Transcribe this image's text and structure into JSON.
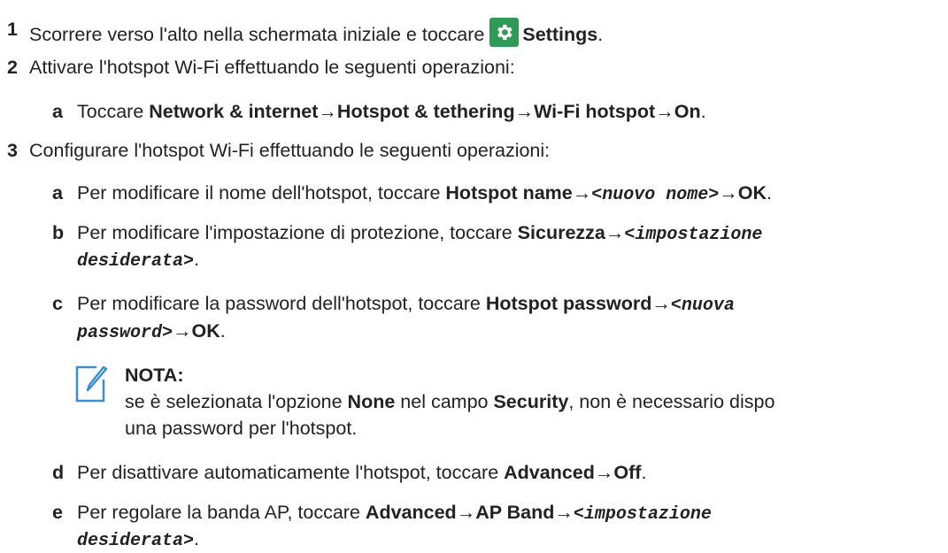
{
  "steps": [
    {
      "num": "1",
      "text": "Scorrere verso l'alto nella schermata iniziale e toccare",
      "bold": "Settings",
      "end": "."
    },
    {
      "num": "2",
      "text": "Attivare l'hotspot Wi-Fi effettuando le seguenti operazioni:"
    },
    {
      "num": "3",
      "text": "Configurare l'hotspot Wi-Fi effettuando le seguenti operazioni:"
    }
  ],
  "step2": {
    "a": {
      "letter": "a",
      "text": "Toccare",
      "p1": "Network & internet",
      "arrow": "→",
      "p2": "Hotspot & tethering",
      "p3": "Wi-Fi hotspot",
      "p4": "On",
      "end": "."
    }
  },
  "step3": {
    "a": {
      "letter": "a",
      "text": "Per modificare il nome dell'hotspot, toccare",
      "p1": "Hotspot name",
      "arrow": "→",
      "mono": "<nuovo nome>",
      "p2": "OK",
      "end": "."
    },
    "b": {
      "letter": "b",
      "text": "Per modificare l'impostazione di protezione, toccare",
      "p1": "Sicurezza",
      "arrow": "→",
      "mono1": "<impostazione",
      "mono2": "desiderata>",
      "end": "."
    },
    "c": {
      "letter": "c",
      "text": "Per modificare la password dell'hotspot, toccare",
      "p1": "Hotspot password",
      "arrow": "→",
      "mono1": "<nuova",
      "mono2": "password>",
      "p2": "OK",
      "end": "."
    },
    "note": {
      "title": "NOTA:",
      "t1": "se è selezionata l'opzione",
      "b1": "None",
      "t2": "nel campo",
      "b2": "Security",
      "t3": ", non è necessario dispo",
      "t4": "una password per l'hotspot."
    },
    "d": {
      "letter": "d",
      "text": "Per disattivare automaticamente l'hotspot, toccare",
      "p1": "Advanced",
      "arrow": "→",
      "p2": "Off",
      "end": "."
    },
    "e": {
      "letter": "e",
      "text": "Per regolare la banda AP, toccare",
      "p1": "Advanced",
      "arrow": "→",
      "p2": "AP Band",
      "mono1": "<impostazione",
      "mono2": "desiderata>",
      "end": "."
    }
  },
  "icons": {
    "settings": "gear-icon",
    "note": "note-pencil-icon"
  },
  "colors": {
    "settings_icon_bg": "#2f9a56",
    "note_icon": "#3a8fd0"
  }
}
